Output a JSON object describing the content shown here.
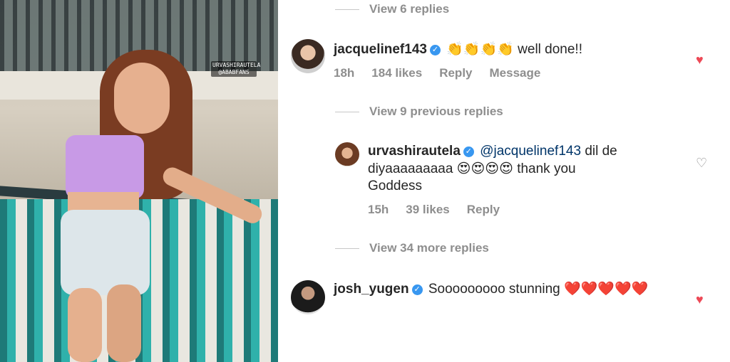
{
  "photo": {
    "watermark_line1": "URVASHIRAUTELA",
    "watermark_line2": "@ABABFANS"
  },
  "thread": [
    {
      "type": "view-more",
      "label": "View 6 replies"
    },
    {
      "type": "comment",
      "username": "jacquelinef143",
      "emojis": "👏👏👏👏",
      "text": "well done!!",
      "time": "18h",
      "likes": "184 likes",
      "reply_label": "Reply",
      "message_label": "Message",
      "liked": true
    },
    {
      "type": "view-more",
      "label": "View 9 previous replies"
    },
    {
      "type": "reply",
      "username": "urvashirautela",
      "mention": "@jacquelinef143",
      "text_part1": "dil de diyaaaaaaaaa",
      "emojis": "😍😍😍😍",
      "text_part2": "thank you Goddess",
      "time": "15h",
      "likes": "39 likes",
      "reply_label": "Reply",
      "liked": false
    },
    {
      "type": "view-more",
      "label": "View 34 more replies"
    },
    {
      "type": "comment",
      "username": "josh_yugen",
      "text": "Sooooooooo stunning",
      "emojis": "❤️❤️❤️❤️❤️",
      "liked": true
    }
  ],
  "colors": {
    "text": "#262626",
    "muted": "#8e8e8e",
    "verified": "#3897f0",
    "liked": "#ed4956",
    "mention": "#003569"
  }
}
